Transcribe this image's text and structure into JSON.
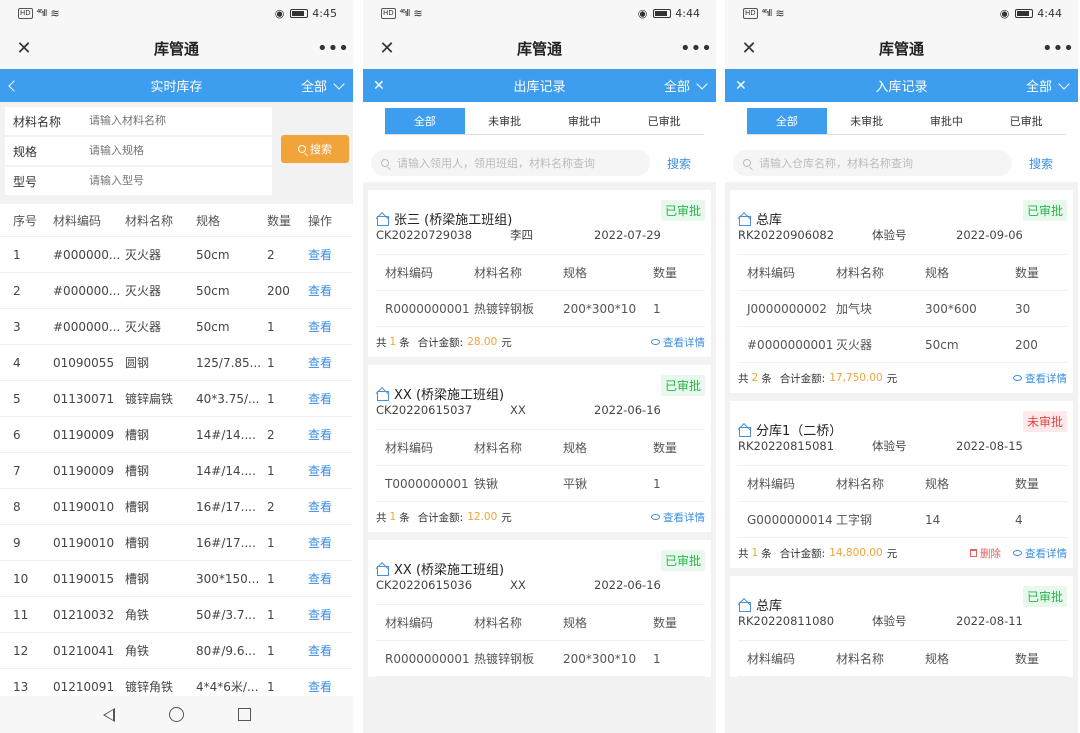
{
  "status": {
    "time1": "4:45",
    "time2": "4:44",
    "time3": "4:44",
    "hd": "HD",
    "signal": "⁴⁶ıll"
  },
  "app": {
    "title": "库管通",
    "close": "✕",
    "more": "•••"
  },
  "inventory": {
    "title": "实时库存",
    "filter": "全部",
    "fields": [
      {
        "label": "材料名称",
        "placeholder": "请输入材料名称"
      },
      {
        "label": "规格",
        "placeholder": "请输入规格"
      },
      {
        "label": "型号",
        "placeholder": "请输入型号"
      }
    ],
    "search_label": "搜索",
    "columns": [
      "序号",
      "材料编码",
      "材料名称",
      "规格",
      "数量",
      "操作"
    ],
    "rows": [
      [
        "1",
        "#000000...",
        "灭火器",
        "50cm",
        "2",
        "查看"
      ],
      [
        "2",
        "#000000...",
        "灭火器",
        "50cm",
        "200",
        "查看"
      ],
      [
        "3",
        "#000000...",
        "灭火器",
        "50cm",
        "1",
        "查看"
      ],
      [
        "4",
        "01090055",
        "圆钢",
        "125/7.85...",
        "1",
        "查看"
      ],
      [
        "5",
        "01130071",
        "镀锌扁铁",
        "40*3.75/...",
        "1",
        "查看"
      ],
      [
        "6",
        "01190009",
        "槽钢",
        "14#/14....",
        "2",
        "查看"
      ],
      [
        "7",
        "01190009",
        "槽钢",
        "14#/14....",
        "1",
        "查看"
      ],
      [
        "8",
        "01190010",
        "槽钢",
        "16#/17....",
        "2",
        "查看"
      ],
      [
        "9",
        "01190010",
        "槽钢",
        "16#/17....",
        "1",
        "查看"
      ],
      [
        "10",
        "01190015",
        "槽钢",
        "300*150...",
        "1",
        "查看"
      ],
      [
        "11",
        "01210032",
        "角铁",
        "50#/3.7...",
        "1",
        "查看"
      ],
      [
        "12",
        "01210041",
        "角铁",
        "80#/9.6...",
        "1",
        "查看"
      ],
      [
        "13",
        "01210091",
        "镀锌角铁",
        "4*4*6米/...",
        "1",
        "查看"
      ]
    ]
  },
  "outbound": {
    "title": "出库记录",
    "filter": "全部",
    "tabs": [
      "全部",
      "未审批",
      "审批中",
      "已审批"
    ],
    "search_placeholder": "请输入领用人，领用班组，材料名称查询",
    "search_label": "搜索",
    "item_columns": [
      "材料编码",
      "材料名称",
      "规格",
      "数量"
    ],
    "cards": [
      {
        "name": "张三 (桥梁施工班组)",
        "status": "已审批",
        "code": "CK20220729038",
        "person": "李四",
        "date": "2022-07-29",
        "items": [
          [
            "R0000000001",
            "热镀锌钢板",
            "200*300*10",
            "1"
          ]
        ],
        "count_pre": "共",
        "count": "1",
        "count_suf": "条",
        "amount_label": "合计金额:",
        "amount": "28.00",
        "unit": "元",
        "detail": "查看详情"
      },
      {
        "name": "XX (桥梁施工班组)",
        "status": "已审批",
        "code": "CK20220615037",
        "person": "XX",
        "date": "2022-06-16",
        "items": [
          [
            "T0000000001",
            "铁锹",
            "平锹",
            "1"
          ]
        ],
        "count_pre": "共",
        "count": "1",
        "count_suf": "条",
        "amount_label": "合计金额:",
        "amount": "12.00",
        "unit": "元",
        "detail": "查看详情"
      },
      {
        "name": "XX (桥梁施工班组)",
        "status": "已审批",
        "code": "CK20220615036",
        "person": "XX",
        "date": "2022-06-16",
        "items": [
          [
            "R0000000001",
            "热镀锌钢板",
            "200*300*10",
            "1"
          ]
        ]
      }
    ]
  },
  "inbound": {
    "title": "入库记录",
    "filter": "全部",
    "tabs": [
      "全部",
      "未审批",
      "审批中",
      "已审批"
    ],
    "search_placeholder": "请输入仓库名称，材料名称查询",
    "search_label": "搜索",
    "item_columns": [
      "材料编码",
      "材料名称",
      "规格",
      "数量"
    ],
    "cards": [
      {
        "name": "总库",
        "status": "已审批",
        "code": "RK20220906082",
        "person": "体验号",
        "date": "2022-09-06",
        "items": [
          [
            "J0000000002",
            "加气块",
            "300*600",
            "30"
          ],
          [
            "#0000000001",
            "灭火器",
            "50cm",
            "200"
          ]
        ],
        "count_pre": "共",
        "count": "2",
        "count_suf": "条",
        "amount_label": "合计金额:",
        "amount": "17,750.00",
        "unit": "元",
        "detail": "查看详情"
      },
      {
        "name": "分库1（二桥）",
        "status": "未审批",
        "code": "RK20220815081",
        "person": "体验号",
        "date": "2022-08-15",
        "items": [
          [
            "G0000000014",
            "工字钢",
            "14",
            "4"
          ]
        ],
        "count_pre": "共",
        "count": "1",
        "count_suf": "条",
        "amount_label": "合计金额:",
        "amount": "14,800.00",
        "unit": "元",
        "delete": "删除",
        "detail": "查看详情"
      },
      {
        "name": "总库",
        "status": "已审批",
        "code": "RK20220811080",
        "person": "体验号",
        "date": "2022-08-11",
        "items": []
      }
    ]
  },
  "colors": {
    "primary": "#3d9ef0",
    "accent": "#f0a43a",
    "approved": "#28b44a",
    "pending": "#e04646"
  }
}
